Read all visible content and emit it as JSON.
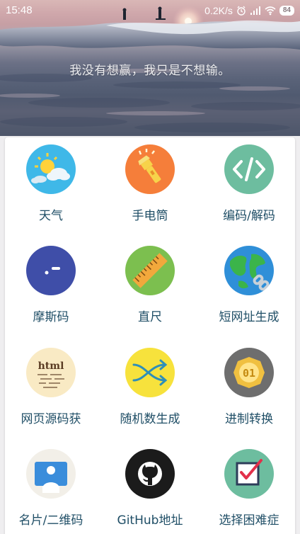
{
  "status_bar": {
    "time": "15:48",
    "net_speed": "0.2K/s",
    "battery": "84"
  },
  "hero": {
    "quote": "我没有想赢，我只是不想输。"
  },
  "tiles": [
    {
      "label": "天气",
      "icon": "weather-icon",
      "color": "#3fb8e8"
    },
    {
      "label": "手电筒",
      "icon": "flashlight-icon",
      "color": "#f57e3a"
    },
    {
      "label": "编码/解码",
      "icon": "code-icon",
      "color": "#6dbd9f"
    },
    {
      "label": "摩斯码",
      "icon": "morse-icon",
      "color": "#3f4ea8"
    },
    {
      "label": "直尺",
      "icon": "ruler-icon",
      "color": "#7cbf4f"
    },
    {
      "label": "短网址生成",
      "icon": "globe-link-icon",
      "color": "#2f8fd8"
    },
    {
      "label": "网页源码获",
      "icon": "html-icon",
      "color": "#f9eac4"
    },
    {
      "label": "随机数生成",
      "icon": "shuffle-icon",
      "color": "#f7e23c"
    },
    {
      "label": "进制转换",
      "icon": "coin-icon",
      "color": "#6e6e6e"
    },
    {
      "label": "名片/二维码",
      "icon": "card-icon",
      "color": "#f2efe8"
    },
    {
      "label": "GitHub地址",
      "icon": "github-icon",
      "color": "#1b1b1b"
    },
    {
      "label": "选择困难症",
      "icon": "checkbox-icon",
      "color": "#6dbd9f"
    }
  ]
}
